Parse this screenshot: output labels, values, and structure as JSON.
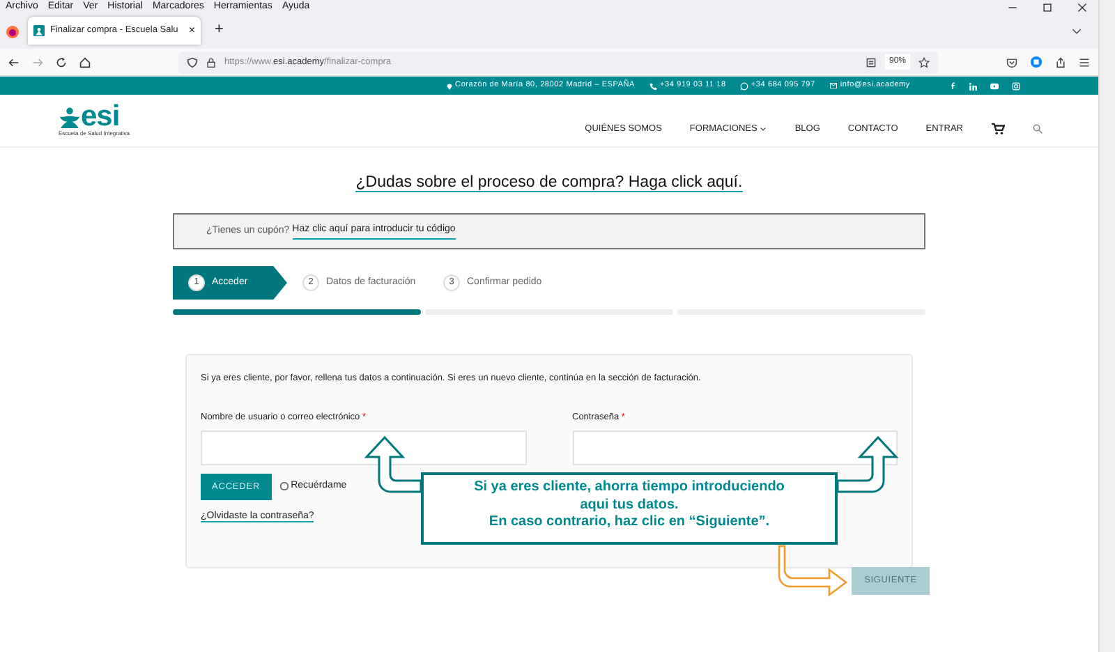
{
  "browser": {
    "menu": [
      "Archivo",
      "Editar",
      "Ver",
      "Historial",
      "Marcadores",
      "Herramientas",
      "Ayuda"
    ],
    "tab": {
      "title": "Finalizar compra - Escuela Salu",
      "close": "×"
    },
    "new_tab": "+",
    "url": "https://www.**esi.academy**/finalizar-compra",
    "zoom": "90%"
  },
  "topbar": {
    "address": "Corazón de María 80, 28002 Madrid – ESPAÑA",
    "phone": "+34 919 03 11 18",
    "whatsapp": "+34 684 095 797",
    "email": "info@esi.academy"
  },
  "logo": {
    "name": "esi",
    "tagline": "Escuela de Salud Integrativa"
  },
  "nav": [
    {
      "label": "QUIÉNES SOMOS",
      "dropdown": false
    },
    {
      "label": "FORMACIONES",
      "dropdown": true
    },
    {
      "label": "BLOG",
      "dropdown": false
    },
    {
      "label": "CONTACTO",
      "dropdown": false
    },
    {
      "label": "ENTRAR",
      "dropdown": false
    }
  ],
  "heading": "¿Dudas sobre el proceso de compra? Haga click aquí.",
  "coupon": {
    "question": "¿Tienes un cupón?",
    "link": "Haz clic aquí para introducir tu código"
  },
  "steps": [
    {
      "number": "1",
      "label": "Acceder",
      "selected": true
    },
    {
      "number": "2",
      "label": "Datos de facturación",
      "selected": false
    },
    {
      "number": "3",
      "label": "Confirmar pedido",
      "selected": false
    }
  ],
  "login": {
    "intro": "Si ya eres cliente, por favor, rellena tus datos a continuación. Si eres un nuevo cliente, continúa en la sección de facturación.",
    "fields": [
      {
        "label": "Nombre de usuario o correo electrónico",
        "required": "*"
      },
      {
        "label": "Contraseña",
        "required": "*"
      }
    ],
    "button": "ACCEDER",
    "remember": {
      "label": "Recuérdame",
      "checked": false
    },
    "lost_password": "¿Olvidaste la contraseña?"
  },
  "callout": "Si ya eres cliente, ahorra tiempo introduciendo\naqui tus datos.\nEn caso contrario, haz clic en “Siguiente”.",
  "next_button": "SIGUIENTE"
}
